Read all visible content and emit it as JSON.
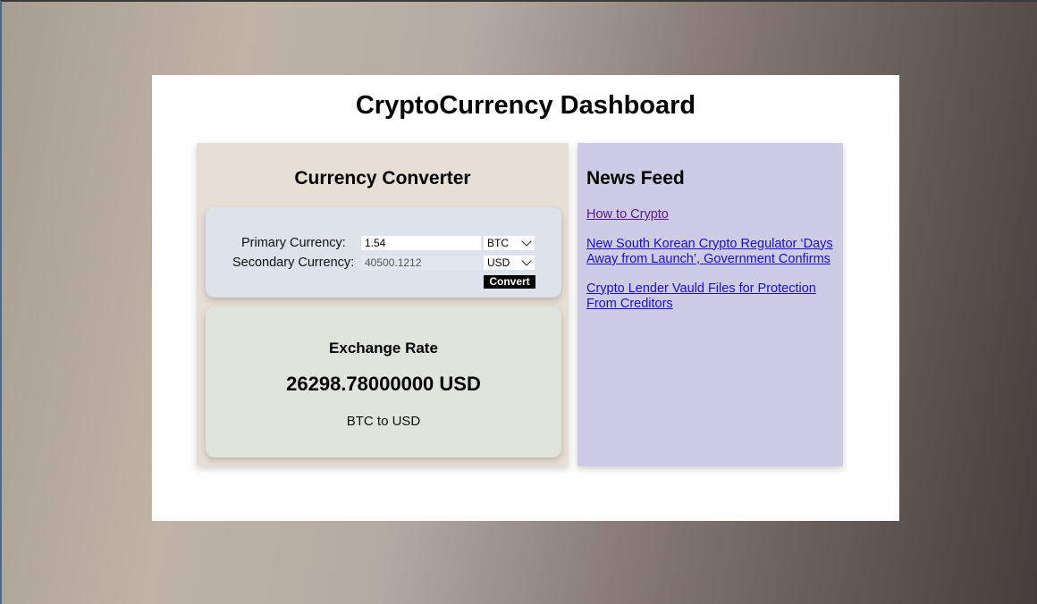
{
  "dashboard": {
    "title": "CryptoCurrency Dashboard"
  },
  "converter": {
    "title": "Currency Converter",
    "primary_label": "Primary Currency:",
    "primary_value": "1.54",
    "primary_currency": "BTC",
    "secondary_label": "Secondary Currency:",
    "secondary_value": "40500.1212",
    "secondary_currency": "USD",
    "convert_label": "Convert"
  },
  "exchange": {
    "title": "Exchange Rate",
    "value": "26298.78000000 USD",
    "pair": "BTC to USD"
  },
  "news": {
    "title": "News Feed",
    "items": [
      {
        "label": "How to Crypto",
        "visited": true
      },
      {
        "label": "New South Korean Crypto Regulator ‘Days Away from Launch’, Government Confirms",
        "visited": false
      },
      {
        "label": "Crypto Lender Vauld Files for Protection From Creditors",
        "visited": false
      }
    ]
  },
  "colors": {
    "link": "#1a0fcc",
    "link_visited": "#551a8b",
    "converter_bg": "#e6dfd5",
    "form_bg": "#dde2ec",
    "exchange_bg": "#dfe5dd",
    "news_bg": "#cecbe6"
  }
}
